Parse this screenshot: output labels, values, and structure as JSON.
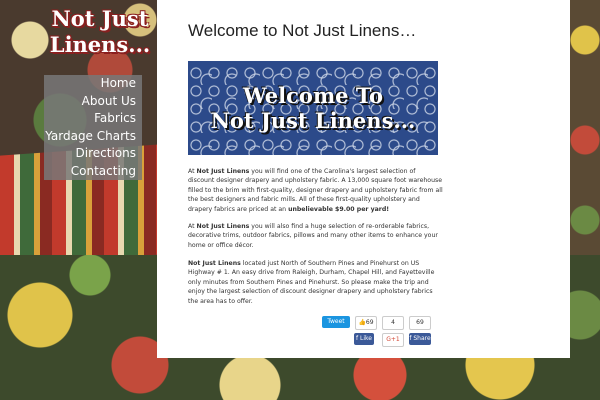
{
  "logo": {
    "text": "Not Just\nLinens..."
  },
  "nav": {
    "items": [
      {
        "label": "Home"
      },
      {
        "label": "About Us"
      },
      {
        "label": "Fabrics"
      },
      {
        "label": "Yardage Charts"
      },
      {
        "label": "Directions"
      },
      {
        "label": "Contacting"
      }
    ]
  },
  "main": {
    "title": "Welcome to Not Just Linens…",
    "banner": {
      "line1": "Welcome To",
      "line2": "Not Just Linens..."
    },
    "p1": {
      "a": "At ",
      "b": "Not Just Linens",
      "c": " you will find one of the Carolina's largest selection of discount designer drapery and upholstery fabric. A 13,000 square foot warehouse filled to the brim with first-quality, designer drapery and upholstery fabric from all the best designers and fabric mills. All of these first-quality upholstery and drapery fabrics are priced at an ",
      "d": "unbelievable $9.00 per yard!"
    },
    "p2": {
      "a": "At ",
      "b": "Not Just Linens",
      "c": " you will also find a huge selection of re-orderable fabrics, decorative trims, outdoor fabrics, pillows and many other items to enhance your home or office décor."
    },
    "p3": {
      "b": "Not Just Linens",
      "c": " located just North of Southern Pines and Pinehurst on US Highway # 1.  An easy drive from Raleigh, Durham, Chapel Hill, and Fayetteville only minutes from Southern Pines and Pinehurst. So please make the trip and enjoy the largest selection of discount designer drapery and upholstery fabrics the area has to offer."
    }
  },
  "share": {
    "tweet_label": "Tweet",
    "like_count": "69",
    "gplus_count": "4",
    "share_count": "69",
    "like_label": "Like",
    "gplus_label": "G+1",
    "share_label": "Share"
  },
  "colors": {
    "nav_bg": "#787878",
    "banner_bg": "#2c4a8a",
    "logo_shadow": "#8a1f1f",
    "facebook": "#3b5998",
    "twitter": "#1b95e0"
  }
}
